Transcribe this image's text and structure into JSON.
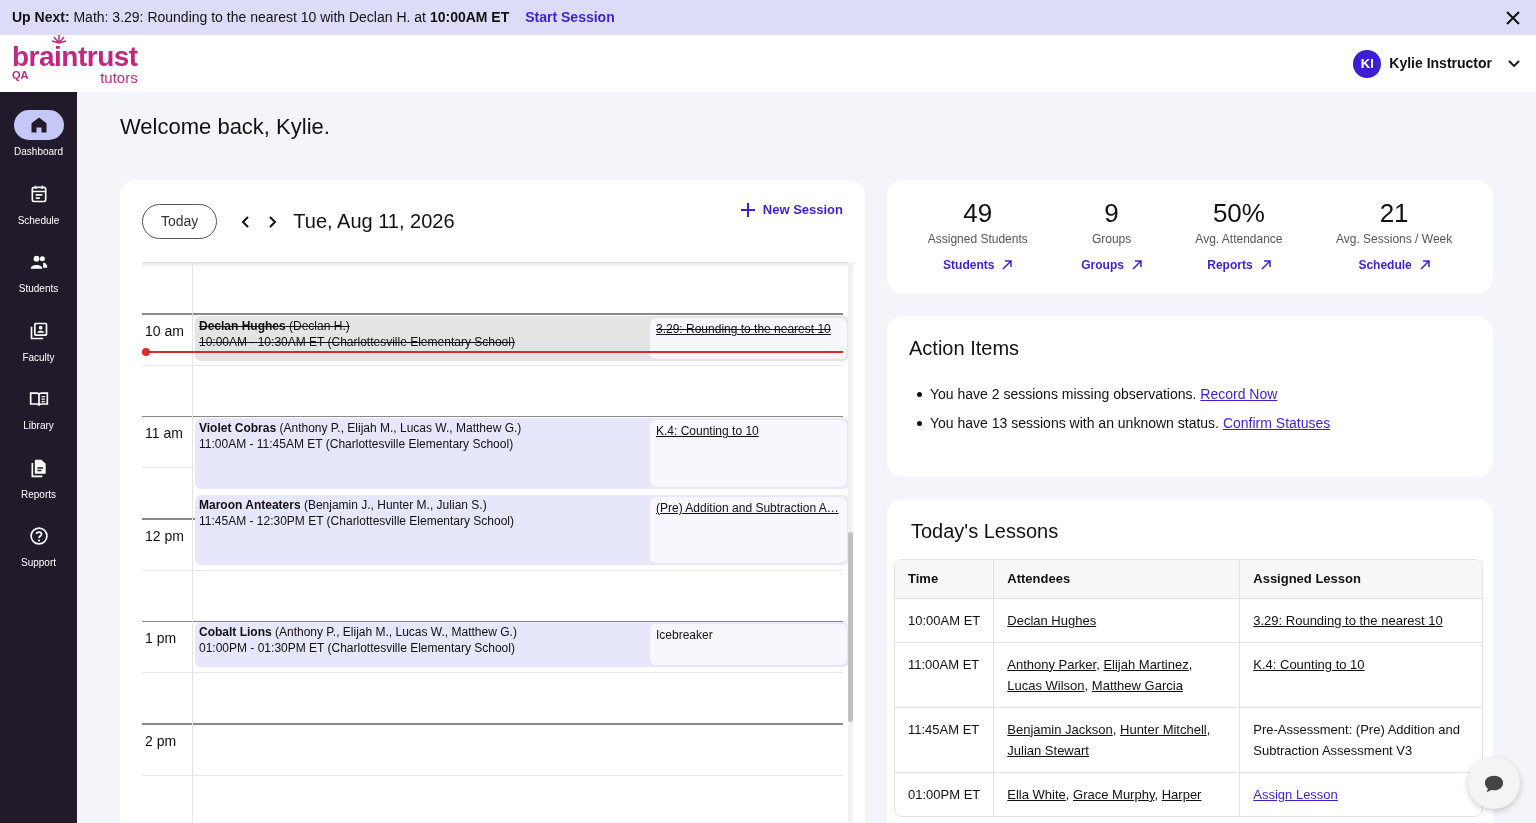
{
  "banner": {
    "text": "**Up Next:** Math: 3.29: Rounding to the nearest 10 with Declan H. at **10:00AM ET**",
    "action": "Start Session"
  },
  "logo": {
    "word": "braintrust",
    "sub": "tutors",
    "env": "QA"
  },
  "user": {
    "initials": "KI",
    "name": "Kylie Instructor"
  },
  "sidebar": {
    "items": [
      {
        "label": "Dashboard",
        "selected": true
      },
      {
        "label": "Schedule",
        "selected": false
      },
      {
        "label": "Students",
        "selected": false
      },
      {
        "label": "Faculty",
        "selected": false
      },
      {
        "label": "Library",
        "selected": false
      },
      {
        "label": "Reports",
        "selected": false
      },
      {
        "label": "Support",
        "selected": false
      }
    ]
  },
  "greeting": "Welcome back, Kylie.",
  "calendar": {
    "today_button": "Today",
    "date": "Tue, Aug 11, 2026",
    "new_session": "New Session",
    "hours": [
      "10 am",
      "11 am",
      "12 pm",
      "1 pm",
      "2 pm"
    ],
    "events": [
      {
        "title": "**Declan Hughes** (Declan H.)",
        "time": "10:00AM - 10:30AM ET (Charlottesville Elementary School)",
        "lesson": {
          "text": "3.29: Rounding to the nearest 10",
          "kind": "link"
        },
        "struck": true
      },
      {
        "title": "**Violet Cobras** (Anthony P., Elijah M., Lucas W., Matthew G.)",
        "time": "11:00AM - 11:45AM ET (Charlottesville Elementary School)",
        "lesson": {
          "text": "K.4: Counting to 10",
          "kind": "link"
        },
        "struck": false
      },
      {
        "title": "**Maroon Anteaters** (Benjamin J., Hunter M., Julian S.)",
        "time": "11:45AM - 12:30PM ET (Charlottesville Elementary School)",
        "lesson": {
          "text": "(Pre) Addition and Subtraction A…",
          "kind": "link"
        },
        "struck": false
      },
      {
        "title": "**Cobalt Lions** (Anthony P., Elijah M., Lucas W., Matthew G.)",
        "time": "01:00PM - 01:30PM ET (Charlottesville Elementary School)",
        "lesson": {
          "text": "Icebreaker",
          "kind": "text"
        },
        "struck": false
      }
    ]
  },
  "stats": [
    {
      "value": "49",
      "label": "Assigned Students",
      "link": "Students"
    },
    {
      "value": "9",
      "label": "Groups",
      "link": "Groups"
    },
    {
      "value": "50%",
      "label": "Avg. Attendance",
      "link": "Reports"
    },
    {
      "value": "21",
      "label": "Avg. Sessions / Week",
      "link": "Schedule"
    }
  ],
  "action_items": {
    "title": "Action Items",
    "items": [
      {
        "text": "You have 2 sessions missing observations.",
        "link": "Record Now"
      },
      {
        "text": "You have 13 sessions with an unknown status.",
        "link": "Confirm Statuses"
      }
    ]
  },
  "lessons": {
    "title": "Today's Lessons",
    "columns": [
      "Time",
      "Attendees",
      "Assigned Lesson"
    ],
    "rows": [
      {
        "time": "10:00AM ET",
        "attendees": [
          {
            "name": "Declan Hughes"
          }
        ],
        "lesson": {
          "text": "3.29: Rounding to the nearest 10",
          "kind": "link"
        }
      },
      {
        "time": "11:00AM ET",
        "attendees": [
          {
            "name": "Anthony Parker",
            "after": ","
          },
          {
            "name": "Elijah Martinez",
            "after": ","
          },
          {
            "name": "Lucas Wilson",
            "after": ","
          },
          {
            "name": "Matthew Garcia"
          }
        ],
        "lesson": {
          "text": "K.4: Counting to 10",
          "kind": "link"
        }
      },
      {
        "time": "11:45AM ET",
        "attendees": [
          {
            "name": "Benjamin Jackson",
            "after": ","
          },
          {
            "name": "Hunter Mitchell",
            "after": ","
          },
          {
            "name": "Julian Stewart"
          }
        ],
        "lesson": {
          "text": "Pre-Assessment: (Pre) Addition and Subtraction Assessment V3",
          "kind": "text"
        }
      },
      {
        "time": "01:00PM ET",
        "attendees": [
          {
            "name": "Ella White",
            "after": ","
          },
          {
            "name": "Grace Murphy",
            "after": ","
          },
          {
            "name": "Harper"
          }
        ],
        "lesson": {
          "text": "Assign Lesson",
          "kind": "action"
        }
      }
    ]
  }
}
